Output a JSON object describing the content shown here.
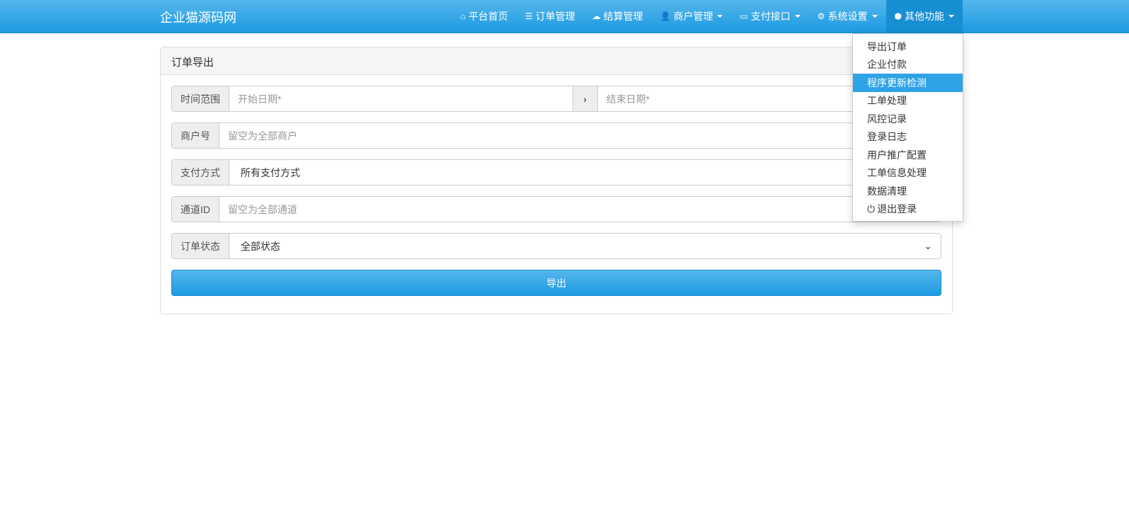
{
  "brand": "企业猫源码网",
  "nav": [
    {
      "label": "平台首页",
      "icon": "home-icon",
      "glyph": "⌂"
    },
    {
      "label": "订单管理",
      "icon": "list-icon",
      "glyph": "☰"
    },
    {
      "label": "结算管理",
      "icon": "cloud-icon",
      "glyph": "☁"
    },
    {
      "label": "商户管理",
      "icon": "user-icon",
      "glyph": "👤",
      "dropdown": true
    },
    {
      "label": "支付接口",
      "icon": "credit-card-icon",
      "glyph": "▭",
      "dropdown": true
    },
    {
      "label": "系统设置",
      "icon": "gear-icon",
      "glyph": "⚙",
      "dropdown": true
    },
    {
      "label": "其他功能",
      "icon": "cube-icon",
      "glyph": "⬢",
      "dropdown": true,
      "active": true
    }
  ],
  "dropdown": [
    "导出订单",
    "企业付款",
    "程序更新检测",
    "工单处理",
    "风控记录",
    "登录日志",
    "用户推广配置",
    "工单信息处理",
    "数据清理",
    "退出登录"
  ],
  "highlighted": "程序更新检测",
  "panel": {
    "title": "订单导出",
    "time_label": "时间范围",
    "start_placeholder": "开始日期*",
    "end_placeholder": "结束日期*",
    "merchant_label": "商户号",
    "merchant_placeholder": "留空为全部商户",
    "pay_label": "支付方式",
    "pay_value": "所有支付方式",
    "channel_label": "通道ID",
    "channel_placeholder": "留空为全部通道",
    "status_label": "订单状态",
    "status_value": "全部状态",
    "export_button": "导出"
  }
}
